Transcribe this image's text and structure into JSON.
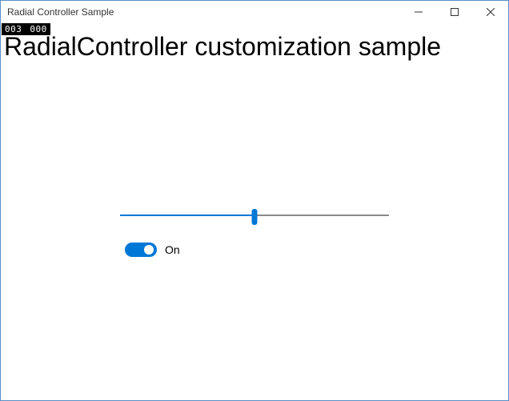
{
  "window": {
    "title": "Radial Controller Sample"
  },
  "debug": {
    "left": "003",
    "right": "000"
  },
  "heading": "RadialController customization sample",
  "slider": {
    "value": 50,
    "min": 0,
    "max": 100
  },
  "toggle": {
    "state": true,
    "label": "On"
  }
}
